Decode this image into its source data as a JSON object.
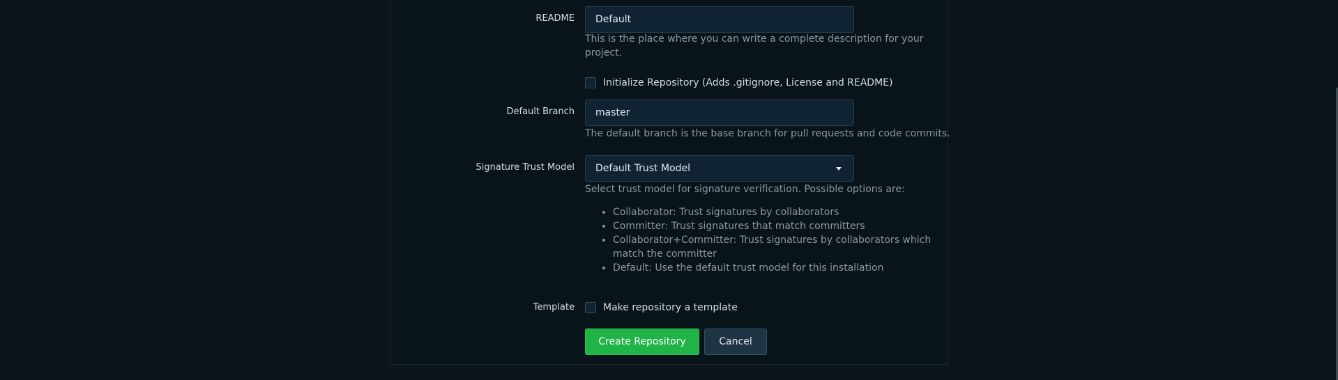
{
  "form": {
    "readme": {
      "label": "README",
      "value": "Default",
      "help_line1": "This is the place where you can write a complete description for your",
      "help_line2": "project."
    },
    "init_repo": {
      "label": "Initialize Repository (Adds .gitignore, License and README)",
      "checked": false
    },
    "default_branch": {
      "label": "Default Branch",
      "value": "master",
      "help": "The default branch is the base branch for pull requests and code commits."
    },
    "trust_model": {
      "label": "Signature Trust Model",
      "value": "Default Trust Model",
      "help": "Select trust model for signature verification. Possible options are:",
      "options": [
        "Collaborator: Trust signatures by collaborators",
        "Committer: Trust signatures that match committers",
        "Collaborator+Committer: Trust signatures by collaborators which match the committer",
        "Default: Use the default trust model for this installation"
      ]
    },
    "template": {
      "label": "Template",
      "checkbox_label": "Make repository a template",
      "checked": false
    }
  },
  "actions": {
    "create_label": "Create Repository",
    "cancel_label": "Cancel"
  },
  "colors": {
    "primary": "#20b347",
    "background": "#0b1419",
    "panel": "#081419"
  }
}
